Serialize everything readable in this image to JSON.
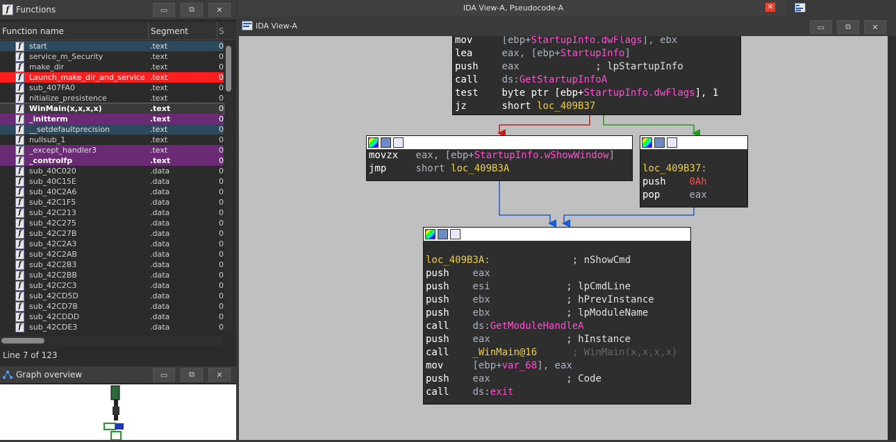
{
  "functions_panel": {
    "title": "Functions",
    "col_name": "Function name",
    "col_segment": "Segment",
    "col_trunc": "S",
    "rows": [
      {
        "name": "start",
        "segment": ".text",
        "t": "0",
        "bg": "#2b4a5e",
        "color": "#e0e0e0",
        "bold": false
      },
      {
        "name": "service_m_Security",
        "segment": ".text",
        "t": "0",
        "bg": "",
        "color": "#d0d0d0",
        "bold": false
      },
      {
        "name": "make_dir",
        "segment": ".text",
        "t": "0",
        "bg": "",
        "color": "#d0d0d0",
        "bold": false
      },
      {
        "name": "Launch_make_dir_and_service",
        "segment": ".text",
        "t": "0",
        "bg": "#ff1e1e",
        "color": "#ffffff",
        "bold": false
      },
      {
        "name": "sub_407FA0",
        "segment": ".text",
        "t": "0",
        "bg": "",
        "color": "#d0d0d0",
        "bold": false
      },
      {
        "name": "nitialize_presistence",
        "segment": ".text",
        "t": "0",
        "bg": "",
        "color": "#d0d0d0",
        "bold": false
      },
      {
        "name": "WinMain(x,x,x,x)",
        "segment": ".text",
        "t": "0",
        "bg": "#3a3a3a",
        "color": "#ffffff",
        "bold": true
      },
      {
        "name": "_initterm",
        "segment": ".text",
        "t": "0",
        "bg": "#6a2a74",
        "color": "#ffffff",
        "bold": true
      },
      {
        "name": "__setdefaultprecision",
        "segment": ".text",
        "t": "0",
        "bg": "#2b4a5e",
        "color": "#e0e0e0",
        "bold": false
      },
      {
        "name": "nullsub_1",
        "segment": ".text",
        "t": "0",
        "bg": "",
        "color": "#d0d0d0",
        "bold": false
      },
      {
        "name": "_except_handler3",
        "segment": ".text",
        "t": "0",
        "bg": "#6a2a74",
        "color": "#e0e0e0",
        "bold": false
      },
      {
        "name": "_controlfp",
        "segment": ".text",
        "t": "0",
        "bg": "#6a2a74",
        "color": "#ffffff",
        "bold": true
      },
      {
        "name": "sub_40C020",
        "segment": ".data",
        "t": "0",
        "bg": "",
        "color": "#d0d0d0",
        "bold": false
      },
      {
        "name": "sub_40C15E",
        "segment": ".data",
        "t": "0",
        "bg": "",
        "color": "#d0d0d0",
        "bold": false
      },
      {
        "name": "sub_40C2A6",
        "segment": ".data",
        "t": "0",
        "bg": "",
        "color": "#d0d0d0",
        "bold": false
      },
      {
        "name": "sub_42C1F5",
        "segment": ".data",
        "t": "0",
        "bg": "",
        "color": "#d0d0d0",
        "bold": false
      },
      {
        "name": "sub_42C213",
        "segment": ".data",
        "t": "0",
        "bg": "",
        "color": "#d0d0d0",
        "bold": false
      },
      {
        "name": "sub_42C275",
        "segment": ".data",
        "t": "0",
        "bg": "",
        "color": "#d0d0d0",
        "bold": false
      },
      {
        "name": "sub_42C27B",
        "segment": ".data",
        "t": "0",
        "bg": "",
        "color": "#d0d0d0",
        "bold": false
      },
      {
        "name": "sub_42C2A3",
        "segment": ".data",
        "t": "0",
        "bg": "",
        "color": "#d0d0d0",
        "bold": false
      },
      {
        "name": "sub_42C2AB",
        "segment": ".data",
        "t": "0",
        "bg": "",
        "color": "#d0d0d0",
        "bold": false
      },
      {
        "name": "sub_42C2B3",
        "segment": ".data",
        "t": "0",
        "bg": "",
        "color": "#d0d0d0",
        "bold": false
      },
      {
        "name": "sub_42C2BB",
        "segment": ".data",
        "t": "0",
        "bg": "",
        "color": "#d0d0d0",
        "bold": false
      },
      {
        "name": "sub_42C2C3",
        "segment": ".data",
        "t": "0",
        "bg": "",
        "color": "#d0d0d0",
        "bold": false
      },
      {
        "name": "sub_42CD5D",
        "segment": ".data",
        "t": "0",
        "bg": "",
        "color": "#d0d0d0",
        "bold": false
      },
      {
        "name": "sub_42CD7B",
        "segment": ".data",
        "t": "0",
        "bg": "",
        "color": "#d0d0d0",
        "bold": false
      },
      {
        "name": "sub_42CDDD",
        "segment": ".data",
        "t": "0",
        "bg": "",
        "color": "#d0d0d0",
        "bold": false
      },
      {
        "name": "sub_42CDE3",
        "segment": ".data",
        "t": "0",
        "bg": "",
        "color": "#d0d0d0",
        "bold": false
      }
    ],
    "status": "Line 7 of 123"
  },
  "graph_overview": {
    "title": "Graph overview"
  },
  "main": {
    "window_title": "IDA View-A, Pseudocode-A",
    "close_glyph": "✕",
    "tab_title": "IDA View-A"
  },
  "window_buttons": {
    "minimize": "▭",
    "restore": "⧉",
    "close": "✕"
  },
  "icons": {
    "function": "function-icon",
    "graph": "graph-overview-icon"
  },
  "colors": {
    "red_highlight": "#ff1e1e",
    "purple_highlight": "#6a2a74",
    "blue_highlight": "#2b4a5e",
    "edge_red": "#c81e1e",
    "edge_green": "#1e9c1e",
    "edge_blue": "#1e5ad2"
  },
  "blocks": {
    "top": [
      [
        [
          "mn",
          "mov     "
        ],
        [
          "op",
          "["
        ],
        [
          "op",
          "ebp+"
        ],
        [
          "sym",
          "StartupInfo.dwFlags"
        ],
        [
          "op",
          "], ebx"
        ]
      ],
      [
        [
          "mn",
          "lea     "
        ],
        [
          "op",
          "eax, ["
        ],
        [
          "op",
          "ebp+"
        ],
        [
          "sym",
          "StartupInfo"
        ],
        [
          "op",
          "]"
        ]
      ],
      [
        [
          "mn",
          "push    "
        ],
        [
          "op",
          "eax"
        ],
        [
          "cmt",
          "             ; lpStartupInfo"
        ]
      ],
      [
        [
          "mn",
          "call    "
        ],
        [
          "op",
          "ds:"
        ],
        [
          "sym",
          "GetStartupInfoA"
        ]
      ],
      [
        [
          "mn",
          "test    "
        ],
        [
          "mn",
          "byte ptr ["
        ],
        [
          "mn",
          "ebp+"
        ],
        [
          "sym",
          "StartupInfo.dwFlags"
        ],
        [
          "mn",
          "], 1"
        ]
      ],
      [
        [
          "mn",
          "jz      "
        ],
        [
          "mn",
          "short "
        ],
        [
          "lbl",
          "loc_409B37"
        ]
      ]
    ],
    "left": [
      [
        [
          "mn",
          "movzx   "
        ],
        [
          "op",
          "eax, ["
        ],
        [
          "op",
          "ebp+"
        ],
        [
          "sym",
          "StartupInfo.wShowWindow"
        ],
        [
          "op",
          "]"
        ]
      ],
      [
        [
          "mn",
          "jmp     "
        ],
        [
          "op",
          "short "
        ],
        [
          "lbl",
          "loc_409B3A"
        ]
      ]
    ],
    "right": [
      [
        [
          "mn",
          ""
        ]
      ],
      [
        [
          "lbl",
          "loc_409B37:"
        ]
      ],
      [
        [
          "mn",
          "push    "
        ],
        [
          "num",
          "0Ah"
        ]
      ],
      [
        [
          "mn",
          "pop     "
        ],
        [
          "op",
          "eax"
        ]
      ]
    ],
    "bottom": [
      [
        [
          "mn",
          ""
        ]
      ],
      [
        [
          "lbl",
          "loc_409B3A:"
        ],
        [
          "cmt",
          "              ; nShowCmd"
        ]
      ],
      [
        [
          "mn",
          "push    "
        ],
        [
          "op",
          "eax"
        ]
      ],
      [
        [
          "mn",
          "push    "
        ],
        [
          "op",
          "esi"
        ],
        [
          "cmt",
          "             ; lpCmdLine"
        ]
      ],
      [
        [
          "mn",
          "push    "
        ],
        [
          "op",
          "ebx"
        ],
        [
          "cmt",
          "             ; hPrevInstance"
        ]
      ],
      [
        [
          "mn",
          "push    "
        ],
        [
          "op",
          "ebx"
        ],
        [
          "cmt",
          "             ; lpModuleName"
        ]
      ],
      [
        [
          "mn",
          "call    "
        ],
        [
          "op",
          "ds:"
        ],
        [
          "sym",
          "GetModuleHandleA"
        ]
      ],
      [
        [
          "mn",
          "push    "
        ],
        [
          "op",
          "eax"
        ],
        [
          "cmt",
          "             ; hInstance"
        ]
      ],
      [
        [
          "mn",
          "call    "
        ],
        [
          "lbl",
          "_WinMain@16"
        ],
        [
          "dim",
          "      ; WinMain(x,x,x,x)"
        ]
      ],
      [
        [
          "mn",
          "mov     "
        ],
        [
          "op",
          "[ebp+"
        ],
        [
          "sym",
          "var_68"
        ],
        [
          "op",
          "], eax"
        ]
      ],
      [
        [
          "mn",
          "push    "
        ],
        [
          "op",
          "eax"
        ],
        [
          "cmt",
          "             ; Code"
        ]
      ],
      [
        [
          "mn",
          "call    "
        ],
        [
          "op",
          "ds:"
        ],
        [
          "sym",
          "exit"
        ]
      ]
    ]
  }
}
